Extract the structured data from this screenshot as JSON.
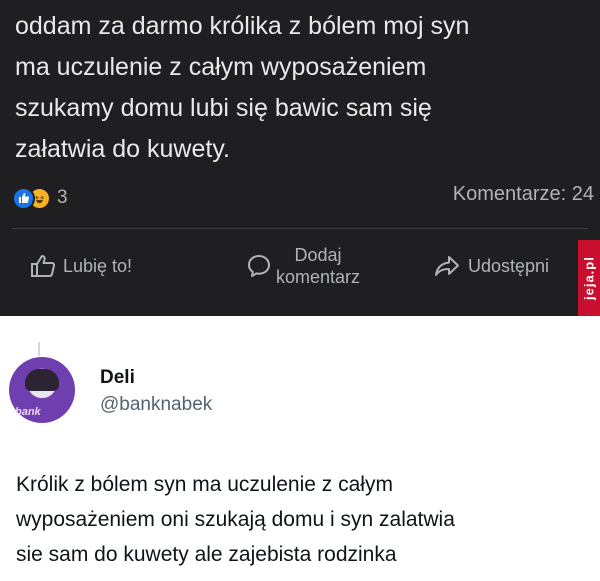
{
  "fb_post": {
    "text_lines": [
      "oddam za darmo królika z bólem moj syn",
      "ma uczulenie z całym wyposażeniem",
      "szukamy domu lubi się bawic sam się",
      "załatwia do kuwety."
    ],
    "reaction_count": "3",
    "comments_label": "Komentarze: 24",
    "actions": {
      "like": "Lubię to!",
      "comment_line1": "Dodaj",
      "comment_line2": "komentarz",
      "share": "Udostępni"
    },
    "reactions": [
      "like-icon",
      "haha-icon"
    ],
    "watermark": "jeja.pl",
    "colors": {
      "background": "#1f1f21",
      "like_blue": "#1b74e4",
      "haha_yellow": "#f7b125",
      "watermark_red": "#c8102e"
    }
  },
  "tweet": {
    "name": "Deli",
    "handle": "@banknabek",
    "avatar_tag": "bank",
    "text_lines": [
      "Królik z bólem syn ma uczulenie z całym",
      "wyposażeniem oni szukają domu i syn zalatwia",
      "sie sam do kuwety ale zajebista rodzinka"
    ]
  }
}
